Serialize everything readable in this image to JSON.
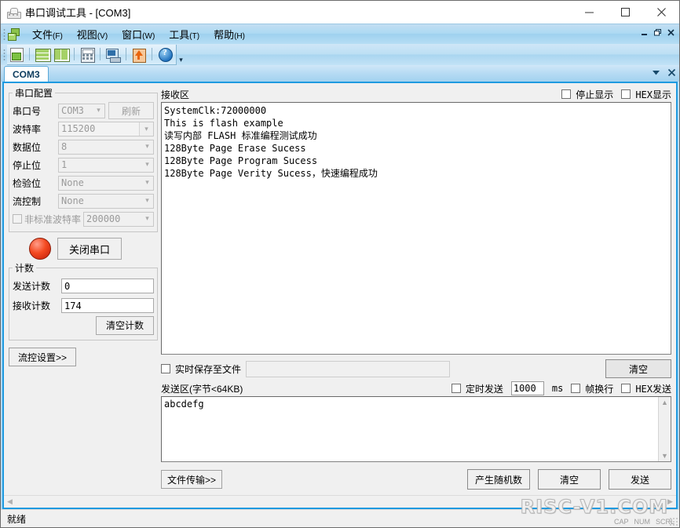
{
  "window": {
    "title": "串口调试工具 - [COM3]",
    "icon": "serial-device-icon",
    "minimize": "—",
    "maximize": "□",
    "close": "✕"
  },
  "mdi_controls": {
    "minimize": "−",
    "restore": "❐",
    "close": "✕"
  },
  "menu": {
    "items": [
      {
        "label": "文件",
        "mnemonic": "(F)"
      },
      {
        "label": "视图",
        "mnemonic": "(V)"
      },
      {
        "label": "窗口",
        "mnemonic": "(W)"
      },
      {
        "label": "工具",
        "mnemonic": "(T)"
      },
      {
        "label": "帮助",
        "mnemonic": "(H)"
      }
    ]
  },
  "toolbar": {
    "buttons": [
      {
        "name": "new-window-icon"
      },
      {
        "name": "tile-horizontal-icon"
      },
      {
        "name": "tile-vertical-icon"
      },
      {
        "name": "calculator-icon"
      },
      {
        "name": "computer-icon"
      },
      {
        "name": "upload-icon"
      },
      {
        "name": "help-icon"
      }
    ],
    "overflow": "▾"
  },
  "tabs": {
    "items": [
      {
        "label": "COM3",
        "active": true
      }
    ],
    "dropdown": "▼",
    "close": "✕"
  },
  "config": {
    "group_title": "串口配置",
    "rows": [
      {
        "label": "串口号",
        "value": "COM3",
        "control": "combo",
        "button": "刷新"
      },
      {
        "label": "波特率",
        "value": "115200",
        "control": "combo-editable"
      },
      {
        "label": "数据位",
        "value": "8",
        "control": "combo"
      },
      {
        "label": "停止位",
        "value": "1",
        "control": "combo"
      },
      {
        "label": "检验位",
        "value": "None",
        "control": "combo"
      },
      {
        "label": "流控制",
        "value": "None",
        "control": "combo"
      }
    ],
    "nonstandard": {
      "label": "非标准波特率",
      "value": "200000",
      "checked": false
    }
  },
  "connection": {
    "led_color": "#e8401a",
    "led_state": "open",
    "button_label": "关闭串口"
  },
  "counter": {
    "group_title": "计数",
    "send_label": "发送计数",
    "send_value": "0",
    "recv_label": "接收计数",
    "recv_value": "174",
    "clear_label": "清空计数"
  },
  "flow_settings_button": "流控设置>>",
  "receive": {
    "title": "接收区",
    "stop_display": {
      "label": "停止显示",
      "checked": false
    },
    "hex_display": {
      "label": "HEX显示",
      "checked": false
    },
    "lines": [
      "SystemClk:72000000",
      "This is flash example",
      "读写内部 FLASH 标准编程测试成功",
      "128Byte Page Erase Sucess",
      "128Byte Page Program Sucess",
      "128Byte Page Verity Sucess，快速编程成功"
    ],
    "save_to_file": {
      "label": "实时保存至文件",
      "checked": false,
      "path": ""
    },
    "clear_label": "清空"
  },
  "send": {
    "title": "发送区(字节<64KB)",
    "timed_send": {
      "label": "定时发送",
      "checked": false
    },
    "interval_value": "1000",
    "interval_unit": "ms",
    "frame_newline": {
      "label": "帧换行",
      "checked": false
    },
    "hex_send": {
      "label": "HEX发送",
      "checked": false
    },
    "text": "abcdefg",
    "file_transfer_label": "文件传输>>",
    "random_label": "产生随机数",
    "clear_label": "清空",
    "send_label": "发送"
  },
  "statusbar": {
    "text": "就绪",
    "indicators": [
      "CAP",
      "NUM",
      "SCRL"
    ]
  },
  "watermark": "RISC-V1.COM"
}
